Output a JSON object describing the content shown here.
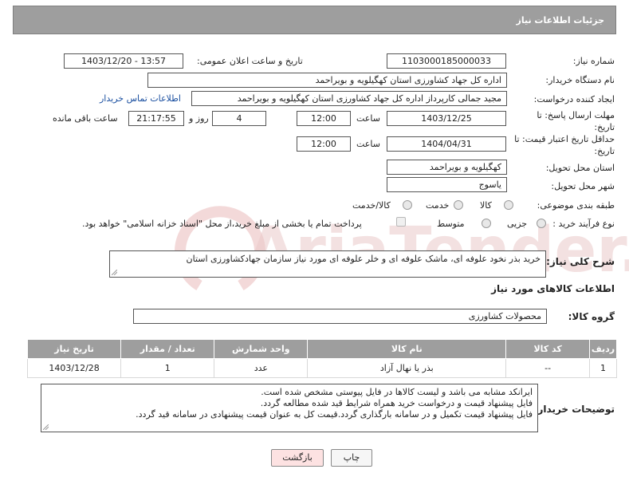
{
  "header": {
    "title": "جزئیات اطلاعات نیاز"
  },
  "form": {
    "need_number_label": "شماره نیاز:",
    "need_number": "1103000185000033",
    "announce_label": "تاریخ و ساعت اعلان عمومی:",
    "announce_value": "1403/12/20 - 13:57",
    "buyer_org_label": "نام دستگاه خریدار:",
    "buyer_org": "اداره کل جهاد کشاورزی استان کهگیلویه و بویراحمد",
    "requester_label": "ایجاد کننده درخواست:",
    "requester": "مجید جمالی کارپرداز اداره کل جهاد کشاورزی استان کهگیلویه و بویراحمد",
    "contact_link": "اطلاعات تماس خریدار",
    "deadline_label": "مهلت ارسال پاسخ: تا تاریخ:",
    "deadline_date": "1403/12/25",
    "time_label": "ساعت",
    "deadline_time": "12:00",
    "days_value": "4",
    "days_label": "روز و",
    "remaining_time": "21:17:55",
    "remaining_label": "ساعت باقی مانده",
    "validity_label": "حداقل تاریخ اعتبار قیمت: تا تاریخ:",
    "validity_date": "1404/04/31",
    "validity_time": "12:00",
    "province_label": "استان محل تحویل:",
    "province": "کهگیلویه و بویراحمد",
    "city_label": "شهر محل تحویل:",
    "city": "یاسوج",
    "category_label": "طبقه بندی موضوعی:",
    "category_options": [
      "کالا",
      "خدمت",
      "کالا/خدمت"
    ],
    "process_label": "نوع فرآیند خرید :",
    "process_options": [
      "جزیی",
      "متوسط"
    ],
    "payment_note": "پرداخت تمام یا بخشی از مبلغ خرید،از محل \"اسناد خزانه اسلامی\" خواهد بود."
  },
  "description": {
    "label": "شرح کلی نیاز:",
    "text": "خرید بذر نخود علوفه ای، ماشک علوفه ای و خلر علوفه ای مورد نیاز سازمان جهادکشاورزی استان"
  },
  "goods": {
    "section_title": "اطلاعات کالاهای مورد نیاز",
    "group_label": "گروه کالا:",
    "group_value": "محصولات کشاورزی",
    "columns": [
      "ردیف",
      "کد کالا",
      "نام کالا",
      "واحد شمارش",
      "تعداد / مقدار",
      "تاریخ نیاز"
    ],
    "rows": [
      {
        "index": "1",
        "code": "--",
        "name": "بذر یا نهال آزاد",
        "unit": "عدد",
        "qty": "1",
        "date": "1403/12/28"
      }
    ]
  },
  "buyer_notes": {
    "label": "توضیحات خریدار:",
    "lines": [
      "ایرانکد مشابه می باشد و لیست کالاها در فایل پیوستی مشخص شده است.",
      "فایل پیشنهاد قیمت و درخواست خرید  همراه شرایط قید شده مطالعه گردد.",
      "فایل پیشنهاد قیمت تکمیل و در سامانه بارگذاری گردد.قیمت کل به عنوان قیمت پیشنهادی در سامانه قید گردد."
    ]
  },
  "buttons": {
    "print": "چاپ",
    "back": "بازگشت"
  },
  "watermark_text": "AriaTender.neT"
}
